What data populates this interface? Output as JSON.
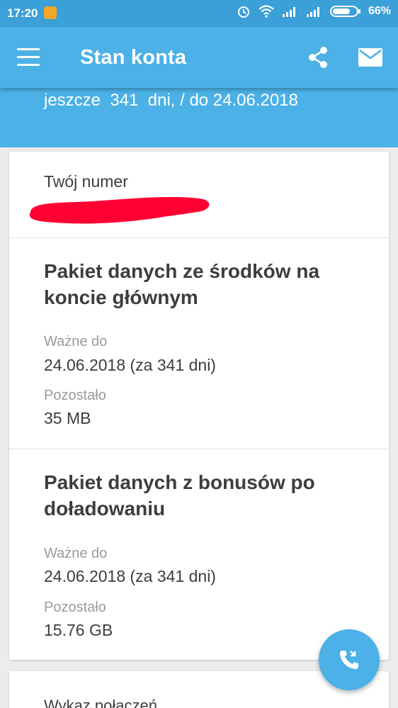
{
  "status_bar": {
    "time": "17:20",
    "battery": "66%"
  },
  "app_bar": {
    "title": "Stan konta"
  },
  "header": {
    "validity": "jeszcze  341  dni, / do 24.06.2018"
  },
  "account": {
    "number_label": "Twój numer"
  },
  "packages": [
    {
      "title_line1": "Pakiet danych ze środków na",
      "title_line2": "koncie głównym",
      "valid_label": "Ważne do",
      "valid_value": "24.06.2018 (za 341 dni)",
      "remaining_label": "Pozostało",
      "remaining_value": "35 MB"
    },
    {
      "title_line1": "Pakiet danych z bonusów po",
      "title_line2": "doładowaniu",
      "valid_label": "Ważne do",
      "valid_value": "24.06.2018 (za 341 dni)",
      "remaining_label": "Pozostało",
      "remaining_value": "15.76 GB"
    }
  ],
  "next_section": {
    "label": "Wykaz połączeń"
  },
  "colors": {
    "primary": "#4bb1e6",
    "status": "#3b9fd8",
    "redaction": "#ff0033",
    "fab": "#4bb1e6"
  },
  "icons": [
    "menu-icon",
    "share-icon",
    "mail-icon",
    "call-icon",
    "alarm-icon",
    "wifi-icon",
    "signal-icon",
    "battery-icon"
  ]
}
